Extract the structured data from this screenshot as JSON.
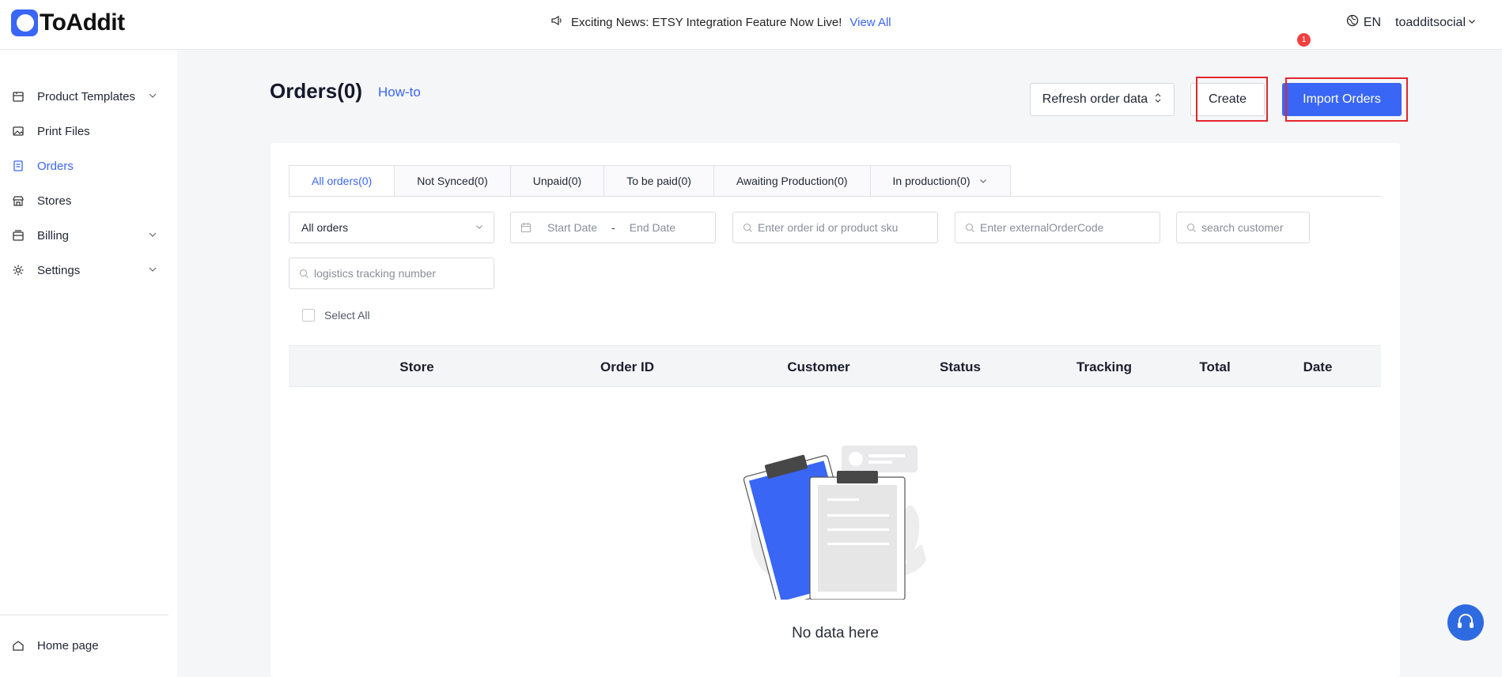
{
  "app": {
    "logo_text": "ToAddit"
  },
  "header": {
    "announcement": "Exciting News: ETSY Integration Feature Now Live!",
    "view_all": "View All",
    "language": "EN",
    "username": "toadditsocial"
  },
  "sidebar": {
    "items": [
      {
        "label": "Product Templates",
        "icon": "box-icon",
        "expandable": true
      },
      {
        "label": "Print Files",
        "icon": "image-icon",
        "expandable": false
      },
      {
        "label": "Orders",
        "icon": "orders-icon",
        "expandable": false,
        "active": true
      },
      {
        "label": "Stores",
        "icon": "store-icon",
        "expandable": false
      },
      {
        "label": "Billing",
        "icon": "billing-icon",
        "expandable": true
      },
      {
        "label": "Settings",
        "icon": "gear-icon",
        "expandable": true
      }
    ],
    "bottom_items": [
      {
        "label": "Home page",
        "icon": "home-icon"
      }
    ]
  },
  "page": {
    "title": "Orders(0)",
    "howto": "How-to",
    "notification_count": "1",
    "buttons": {
      "refresh": "Refresh order data",
      "create": "Create",
      "import": "Import Orders"
    }
  },
  "tabs": [
    {
      "label": "All orders(0)",
      "active": true
    },
    {
      "label": "Not Synced(0)"
    },
    {
      "label": "Unpaid(0)"
    },
    {
      "label": "To be paid(0)"
    },
    {
      "label": "Awaiting Production(0)"
    },
    {
      "label": "In production(0)",
      "dropdown": true
    }
  ],
  "filters": {
    "order_type_value": "All orders",
    "start_date_placeholder": "Start Date",
    "date_separator": "-",
    "end_date_placeholder": "End Date",
    "order_search_placeholder": "Enter order id or product sku",
    "external_code_placeholder": "Enter externalOrderCode",
    "customer_placeholder": "search customer",
    "tracking_placeholder": "logistics tracking number",
    "select_all": "Select All"
  },
  "table": {
    "columns": [
      "Store",
      "Order ID",
      "Customer",
      "Status",
      "Tracking",
      "Total",
      "Date"
    ]
  },
  "empty": {
    "text": "No data here"
  },
  "help": {
    "label": "Help"
  },
  "colors": {
    "accent": "#3a66f5",
    "highlight": "#e5262a",
    "badge": "#f0403f"
  }
}
